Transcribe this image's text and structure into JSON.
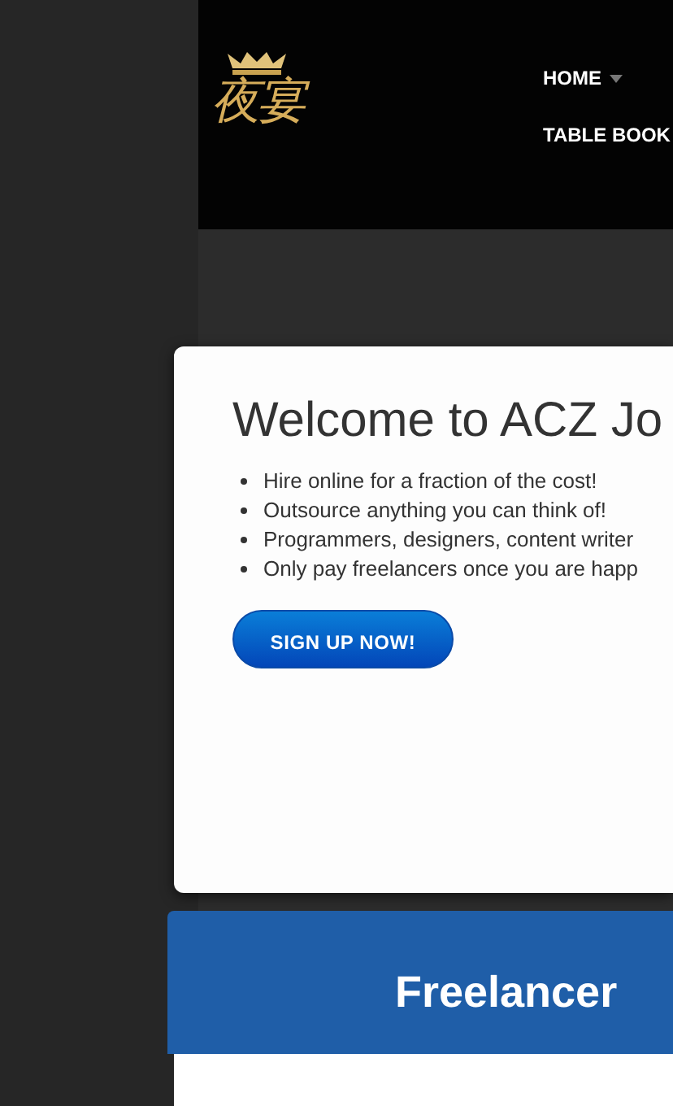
{
  "logo": {
    "text": "夜宴"
  },
  "nav": [
    {
      "label": "HOME",
      "has_dropdown": true
    },
    {
      "label": "TABLE BOOK",
      "has_dropdown": false
    }
  ],
  "hero": {
    "title": "Welcome to ACZ Jo",
    "bullets": [
      "Hire online for a fraction of the cost!",
      "Outsource anything you can think of!",
      "Programmers, designers, content writer",
      "Only pay freelancers once you are happ"
    ],
    "button": "SIGN UP NOW!"
  },
  "section": {
    "title": "Freelancer"
  }
}
